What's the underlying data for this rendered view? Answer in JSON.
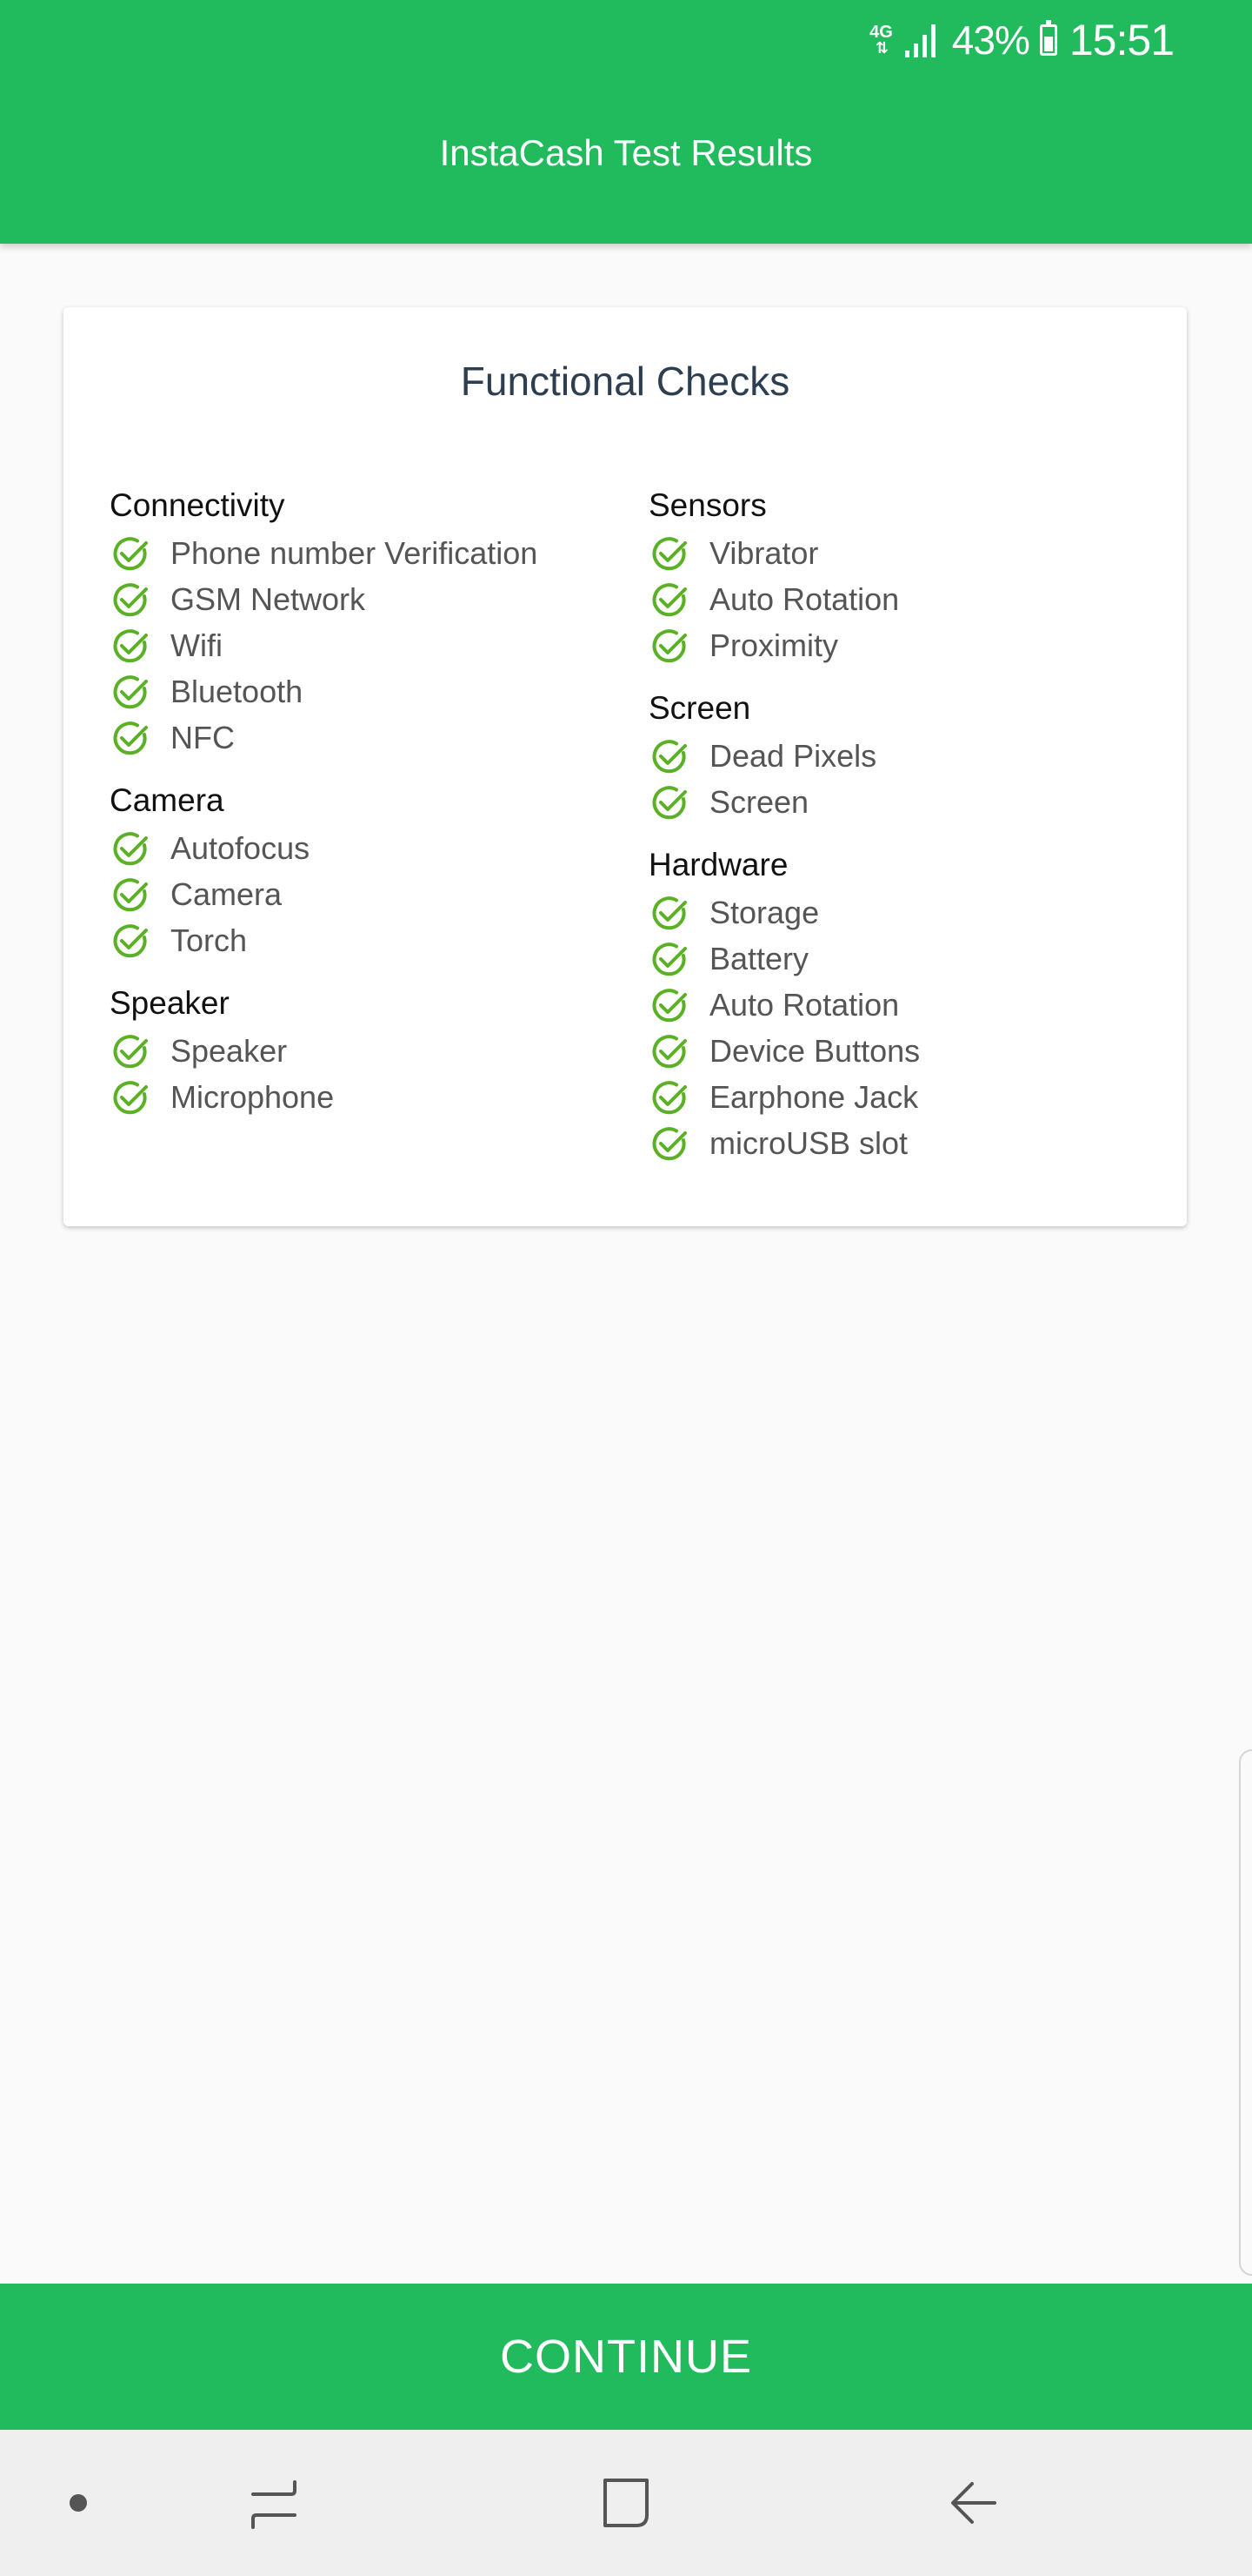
{
  "status_bar": {
    "network": "4G",
    "battery": "43%",
    "time": "15:51"
  },
  "header": {
    "title": "InstaCash Test Results"
  },
  "card": {
    "title": "Functional Checks",
    "left_sections": [
      {
        "title": "Connectivity",
        "items": [
          "Phone number Verification",
          "GSM Network",
          "Wifi",
          "Bluetooth",
          "NFC"
        ]
      },
      {
        "title": "Camera",
        "items": [
          "Autofocus",
          "Camera",
          "Torch"
        ]
      },
      {
        "title": "Speaker",
        "items": [
          "Speaker",
          "Microphone"
        ]
      }
    ],
    "right_sections": [
      {
        "title": "Sensors",
        "items": [
          "Vibrator",
          "Auto Rotation",
          "Proximity"
        ]
      },
      {
        "title": "Screen",
        "items": [
          "Dead Pixels",
          "Screen"
        ]
      },
      {
        "title": "Hardware",
        "items": [
          "Storage",
          "Battery",
          "Auto Rotation",
          "Device Buttons",
          "Earphone Jack",
          "microUSB slot"
        ]
      }
    ]
  },
  "continue_button": {
    "label": "CONTINUE"
  },
  "colors": {
    "brand_green": "#21bb5d",
    "check_green": "#5bb126"
  },
  "icons": {
    "check": "check-circle-icon",
    "nav_recent": "recent-apps-icon",
    "nav_home": "home-icon",
    "nav_back": "back-icon"
  }
}
